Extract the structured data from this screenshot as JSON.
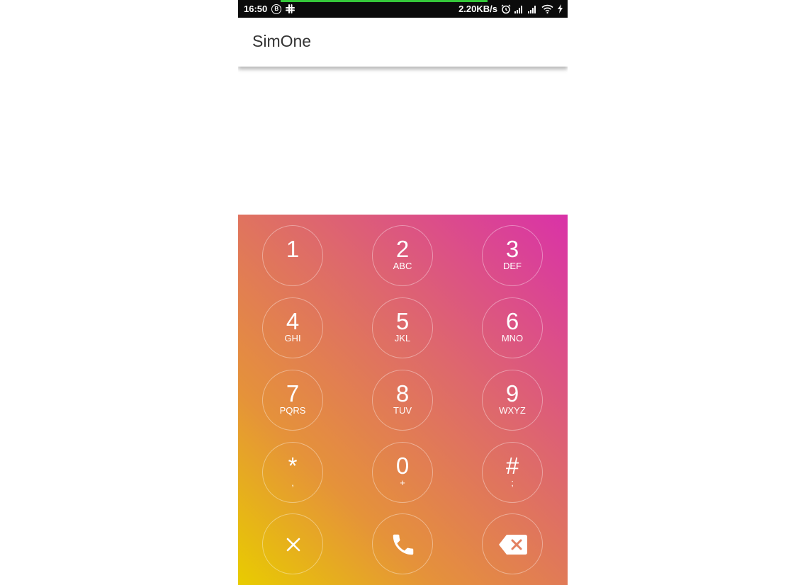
{
  "status_bar": {
    "time": "16:50",
    "b_badge": "B",
    "net_speed": "2.20KB/s",
    "icons": [
      "b-circle-icon",
      "slack-icon",
      "alarm-icon",
      "signal-icon",
      "signal-icon",
      "wifi-icon",
      "charging-icon"
    ],
    "progress": 0.72,
    "progress_color": "#35c83a"
  },
  "app": {
    "title": "SimOne"
  },
  "dialpad": {
    "gradient": [
      "#d932a8",
      "#de6a6a",
      "#e5923a",
      "#e8cc00"
    ],
    "keys": [
      {
        "num": "1",
        "sub": ""
      },
      {
        "num": "2",
        "sub": "ABC"
      },
      {
        "num": "3",
        "sub": "DEF"
      },
      {
        "num": "4",
        "sub": "GHI"
      },
      {
        "num": "5",
        "sub": "JKL"
      },
      {
        "num": "6",
        "sub": "MNO"
      },
      {
        "num": "7",
        "sub": "PQRS"
      },
      {
        "num": "8",
        "sub": "TUV"
      },
      {
        "num": "9",
        "sub": "WXYZ"
      },
      {
        "num": "*",
        "sub": ","
      },
      {
        "num": "0",
        "sub": "+"
      },
      {
        "num": "#",
        "sub": ";"
      }
    ],
    "actions": [
      "close-icon",
      "phone-icon",
      "backspace-icon"
    ]
  }
}
